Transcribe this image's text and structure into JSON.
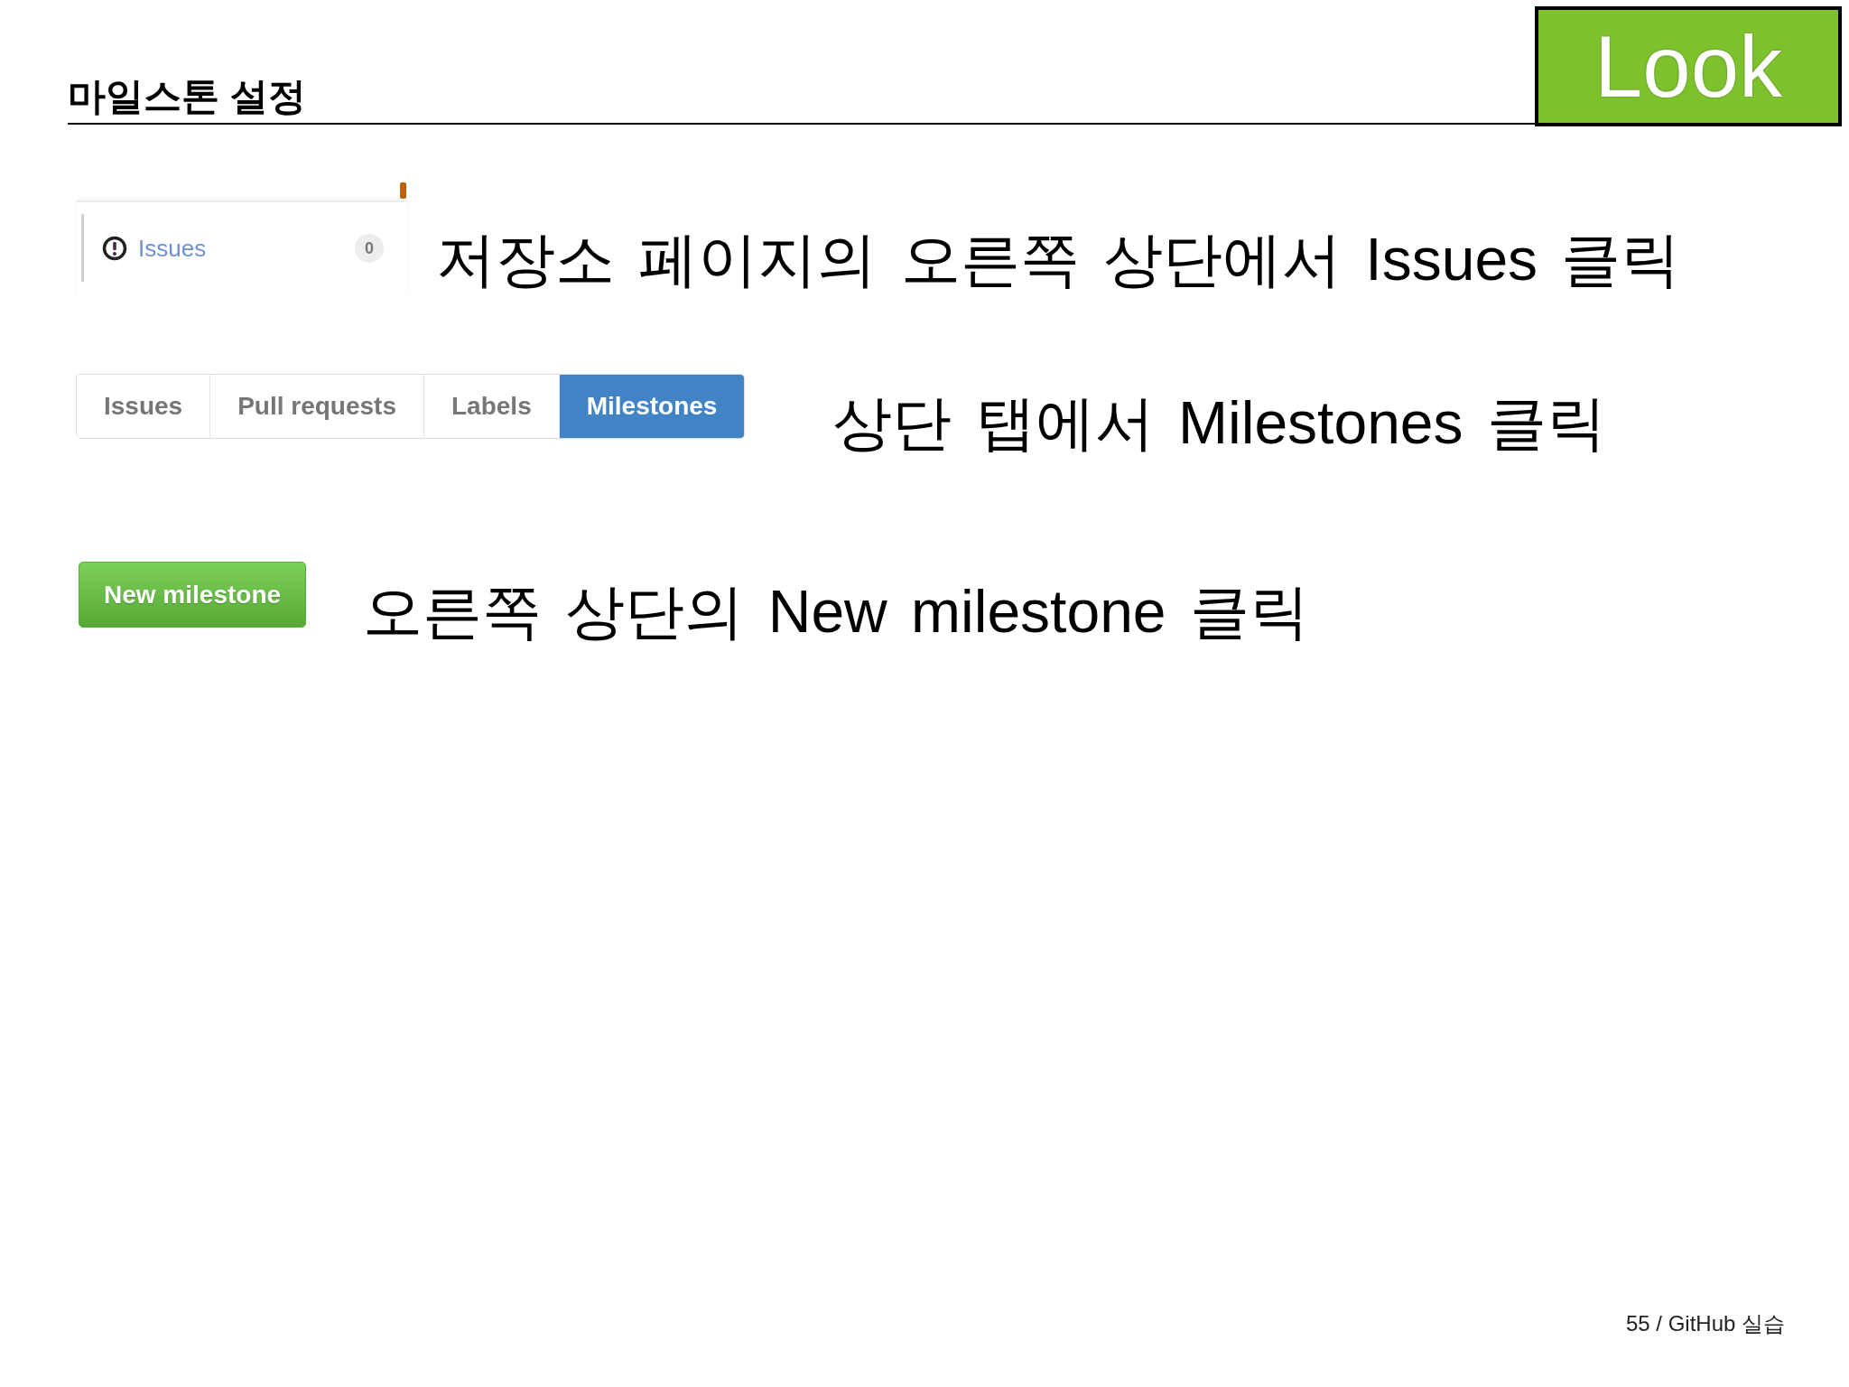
{
  "header": {
    "title": "마일스톤 설정",
    "badge": "Look"
  },
  "steps": [
    {
      "kind": "sidebar",
      "item": {
        "label": "Issues",
        "count": "0"
      },
      "instruction": "저장소 페이지의 오른쪽 상단에서 Issues 클릭"
    },
    {
      "kind": "tabs",
      "tabs": [
        {
          "label": "Issues",
          "selected": false
        },
        {
          "label": "Pull requests",
          "selected": false
        },
        {
          "label": "Labels",
          "selected": false
        },
        {
          "label": "Milestones",
          "selected": true
        }
      ],
      "instruction": "상단 탭에서 Milestones 클릭"
    },
    {
      "kind": "button",
      "button": {
        "label": "New milestone"
      },
      "instruction": "오른쪽 상단의 New milestone 클릭"
    }
  ],
  "footer": {
    "page_label": "55 / GitHub 실습"
  }
}
